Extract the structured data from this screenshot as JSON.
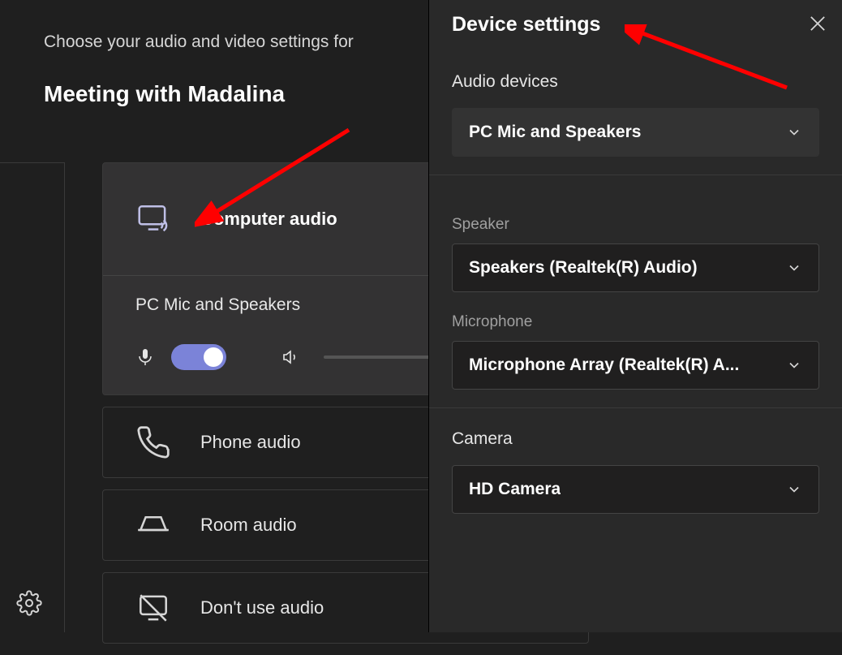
{
  "prejoin": {
    "caption": "Choose your audio and video settings for",
    "meeting_title": "Meeting with Madalina",
    "options": {
      "computer_audio": "Computer audio",
      "phone_audio": "Phone audio",
      "room_audio": "Room audio",
      "no_audio": "Don't use audio"
    },
    "selected_device": "PC Mic and Speakers"
  },
  "device_settings": {
    "title": "Device settings",
    "sections": {
      "audio_devices_label": "Audio devices",
      "audio_device": "PC Mic and Speakers",
      "speaker_label": "Speaker",
      "speaker": "Speakers (Realtek(R) Audio)",
      "microphone_label": "Microphone",
      "microphone": "Microphone Array (Realtek(R) A...",
      "camera_label": "Camera",
      "camera": "HD Camera"
    }
  }
}
